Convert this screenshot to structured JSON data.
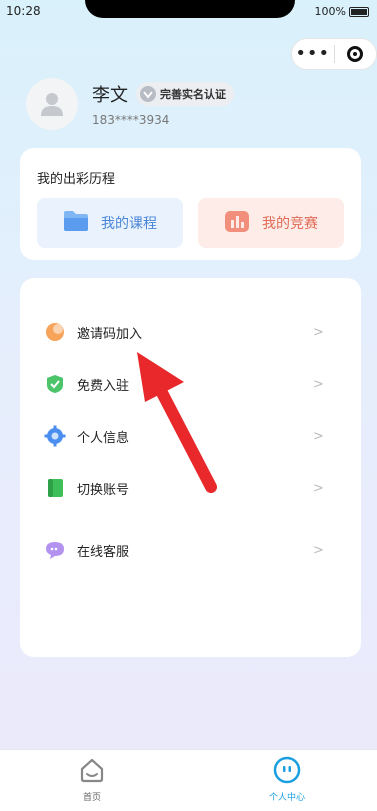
{
  "status_bar": {
    "time": "10:28",
    "battery": "100%"
  },
  "profile": {
    "name": "李文",
    "verify_label": "完善实名认证",
    "phone": "183****3934"
  },
  "history_card": {
    "title": "我的出彩历程",
    "tiles": [
      {
        "label": "我的课程",
        "icon": "folder-icon"
      },
      {
        "label": "我的竞赛",
        "icon": "chart-icon"
      }
    ]
  },
  "menu": {
    "items": [
      {
        "label": "邀请码加入",
        "icon": "invite-code-icon",
        "arrow": ">"
      },
      {
        "label": "免费入驻",
        "icon": "shield-check-icon",
        "arrow": ">"
      },
      {
        "label": "个人信息",
        "icon": "gear-icon",
        "arrow": ">"
      },
      {
        "label": "切换账号",
        "icon": "book-icon",
        "arrow": ">"
      },
      {
        "label": "在线客服",
        "icon": "chat-icon",
        "arrow": ">"
      }
    ]
  },
  "tabbar": {
    "tabs": [
      {
        "label": "首页",
        "icon": "home-icon",
        "active": false
      },
      {
        "label": "个人中心",
        "icon": "profile-face-icon",
        "active": true
      }
    ]
  },
  "colors": {
    "accent": "#1aa0e0",
    "course_tile_text": "#4a86d8",
    "contest_tile_text": "#e06a55",
    "annotation_arrow": "#e8282b"
  }
}
